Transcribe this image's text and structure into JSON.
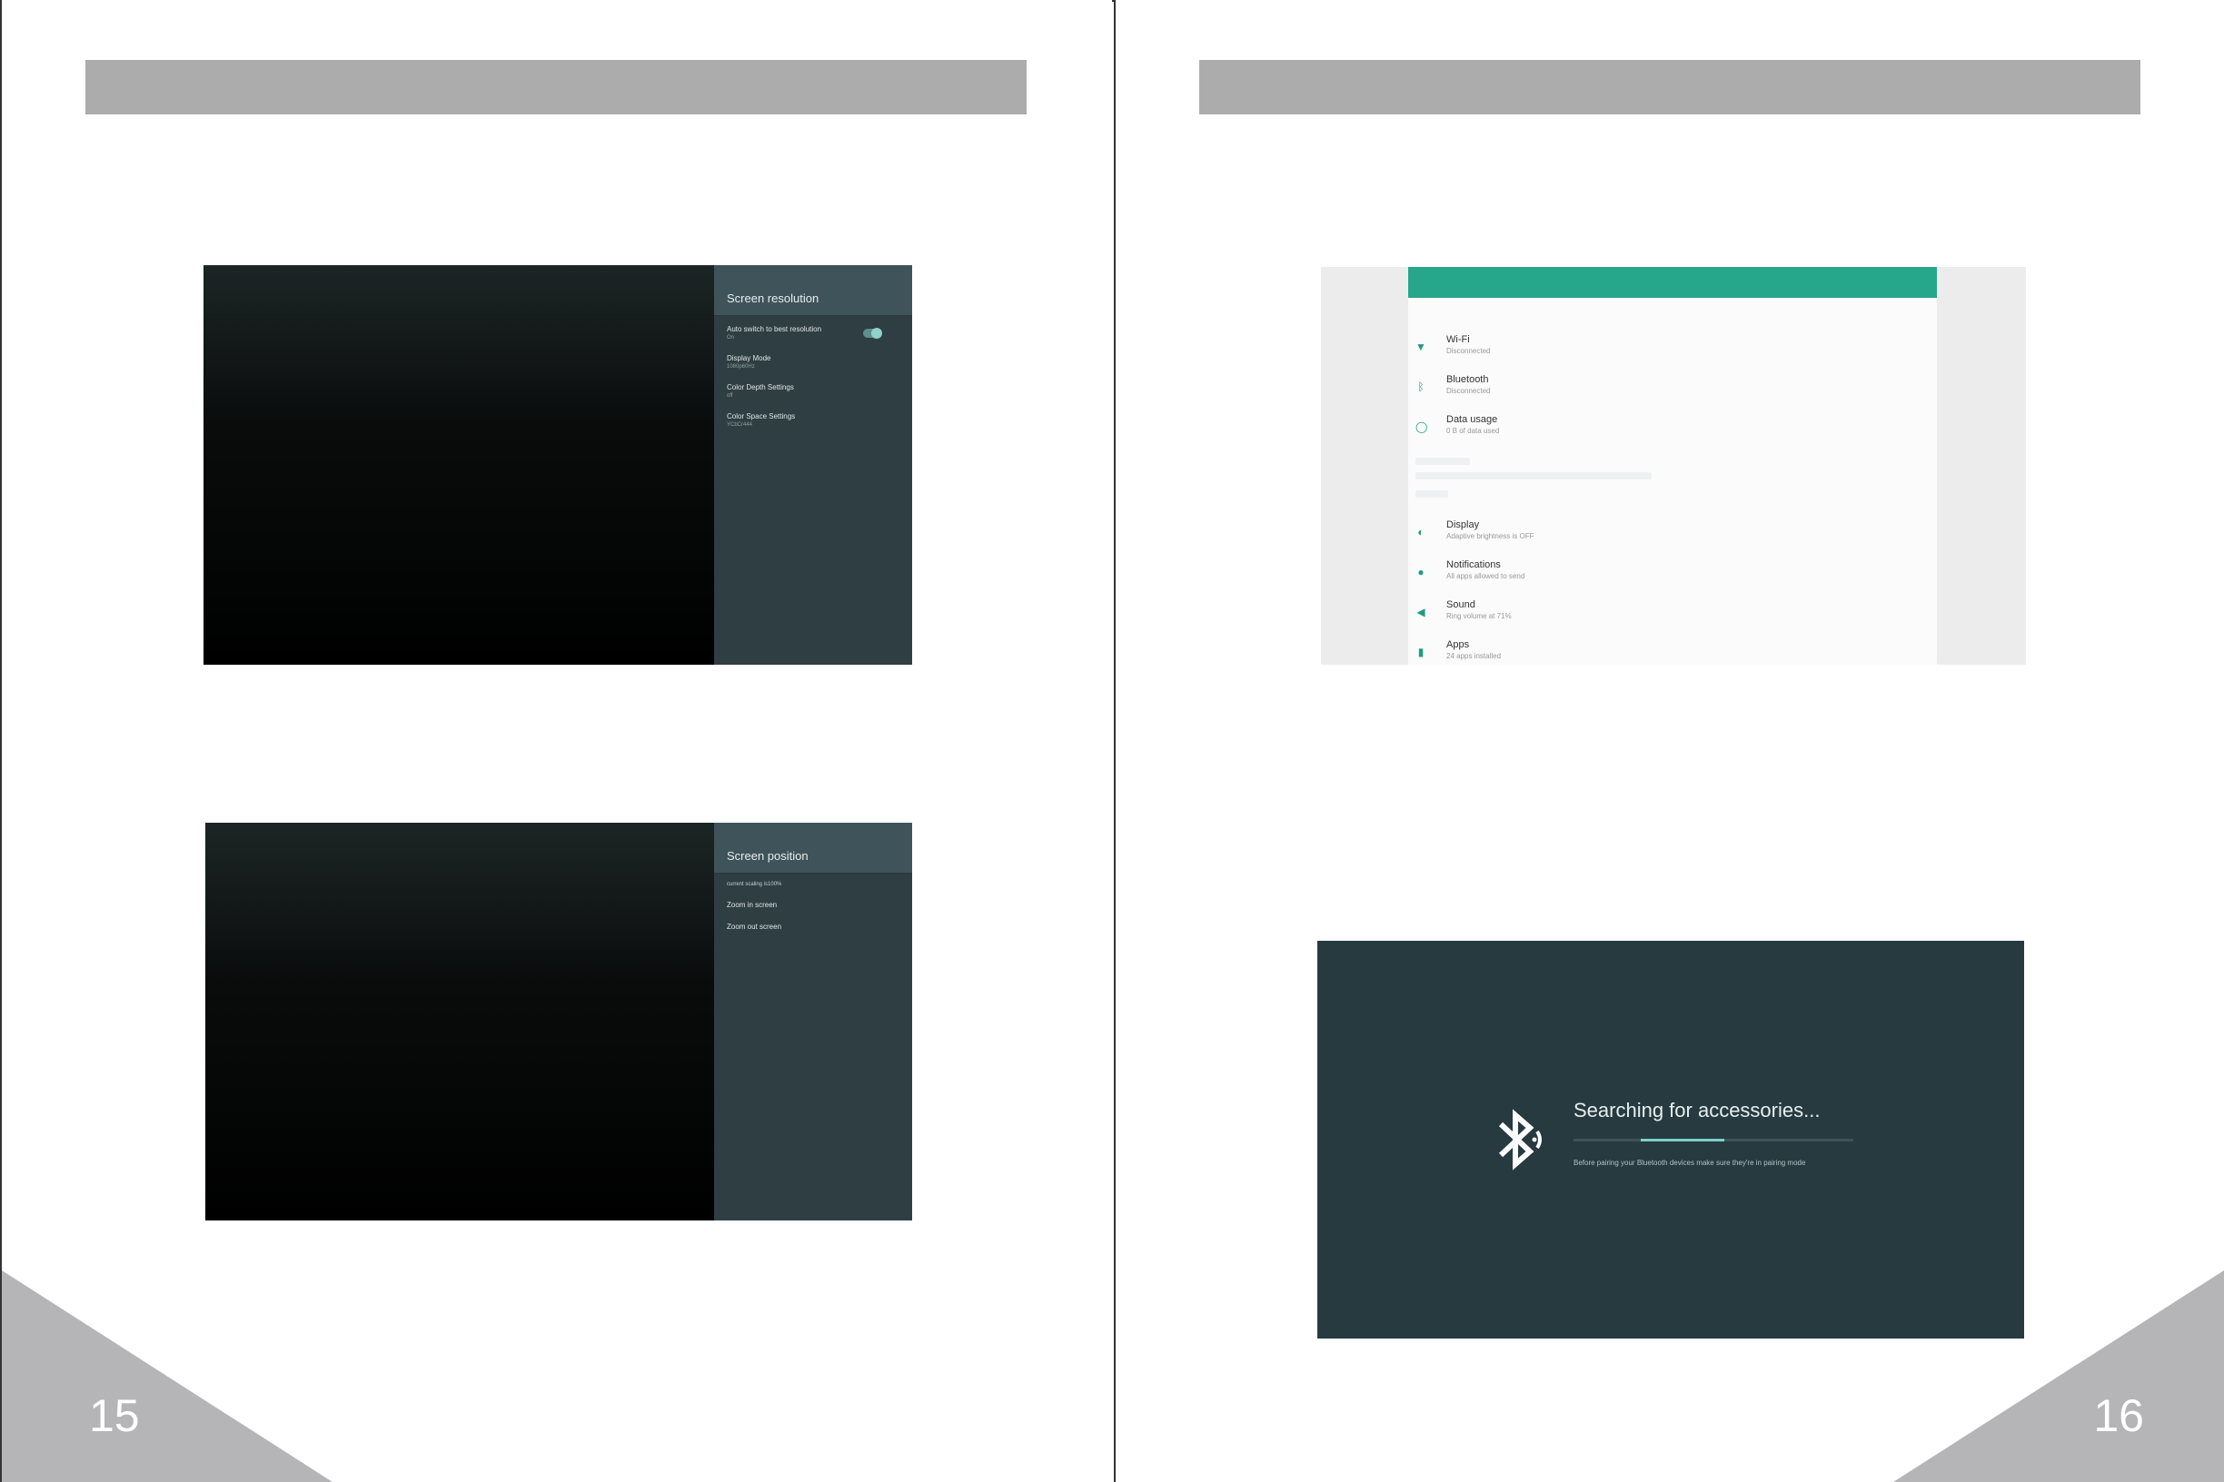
{
  "pages": [
    {
      "number": "15",
      "screens": [
        {
          "title": "Screen resolution",
          "items": [
            {
              "title": "Auto switch to best resolution",
              "subtitle": "On"
            },
            {
              "title": "Display Mode",
              "subtitle": "1080p60Hz"
            },
            {
              "title": "Color Depth Settings",
              "subtitle": "off"
            },
            {
              "title": "Color Space Settings",
              "subtitle": "YCbCr444"
            }
          ]
        },
        {
          "title": "Screen position",
          "items": [
            {
              "title": "current scaling is100%"
            },
            {
              "title": "Zoom in screen"
            },
            {
              "title": "Zoom out screen"
            }
          ]
        }
      ]
    },
    {
      "number": "16",
      "settings": [
        {
          "icon": "wifi-icon",
          "title": "Wi-Fi",
          "subtitle": "Disconnected"
        },
        {
          "icon": "bluetooth-icon",
          "title": "Bluetooth",
          "subtitle": "Disconnected"
        },
        {
          "icon": "data-usage-icon",
          "title": "Data usage",
          "subtitle": "0 B of data used"
        },
        {
          "icon": "display-icon",
          "title": "Display",
          "subtitle": "Adaptive brightness is OFF"
        },
        {
          "icon": "notifications-icon",
          "title": "Notifications",
          "subtitle": "All apps allowed to send"
        },
        {
          "icon": "sound-icon",
          "title": "Sound",
          "subtitle": "Ring volume at 71%"
        },
        {
          "icon": "apps-icon",
          "title": "Apps",
          "subtitle": "24 apps installed"
        }
      ],
      "bluetooth": {
        "title": "Searching for accessories...",
        "subtitle": "Before pairing your Bluetooth devices make sure they're in pairing mode",
        "progress": 0.6
      }
    }
  ],
  "colors": {
    "header_bar": "#acacac",
    "corner": "#b5b5b8",
    "panel": "#2f3e43",
    "accent": "#26a68b",
    "bt_background": "#263a3f"
  }
}
